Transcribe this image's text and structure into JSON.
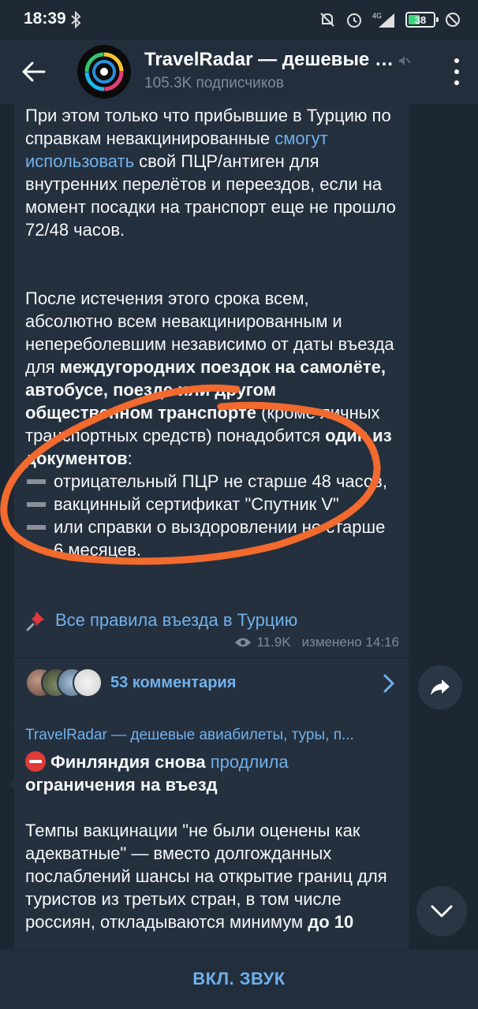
{
  "status_bar": {
    "time": "18:39",
    "network": "4G",
    "battery": "38"
  },
  "header": {
    "title": "TravelRadar — дешевые авиабилеты, туры, п...",
    "subscribers": "105.3K подписчиков"
  },
  "post1": {
    "para1_a": "При этом только что прибывшие в Турцию по справкам невакцинированные ",
    "para1_link": "смогут использовать",
    "para1_b": " свой ПЦР/антиген для внутренних перелётов и переездов, если на момент посадки на транспорт еще не прошло 72/48 часов.",
    "para2_a": "После истечения этого срока всем, абсолютно всем невакцинированным и непереболевшим независимо от даты въезда для ",
    "para2_bold": "междугородних поездок на самолёте, автобусе, поезде или другом общественном транспорте",
    "para2_b": " (кроме личных транспортных средств) понадобится ",
    "para2_bold2": "один из документов",
    "para2_c": ":",
    "doc1": "отрицательный ПЦР не старше 48 часов,",
    "doc2": "вакцинный сертификат \"Спутник V\"",
    "doc3": "или справки о выздоровлении не старше 6 месяцев.",
    "rules_link": "Все правила въезда в Турцию",
    "views": "11.9K",
    "edited": "изменено 14:16",
    "comments": "53 комментария"
  },
  "post2": {
    "forwarded_from": "TravelRadar — дешевые авиабилеты, туры, п...",
    "headline_bold": "Финляндия снова",
    "headline_link": "продлила",
    "headline_bold2": "ограничения на въезд",
    "body_a": "Темпы вакцинации \"не были оценены как адекватные\" — вместо долгожданных послаблений шансы на открытие границ для туристов из третьих стран, в том числе россиян, откладываются минимум ",
    "body_bold": "до 10"
  },
  "bottom_bar": {
    "button": "ВКЛ. ЗВУК"
  },
  "colors": {
    "background": "#1d2733",
    "bubble": "#25303e",
    "header": "#232e3c",
    "link": "#6fb1ec",
    "annotation": "#f26a2e"
  }
}
